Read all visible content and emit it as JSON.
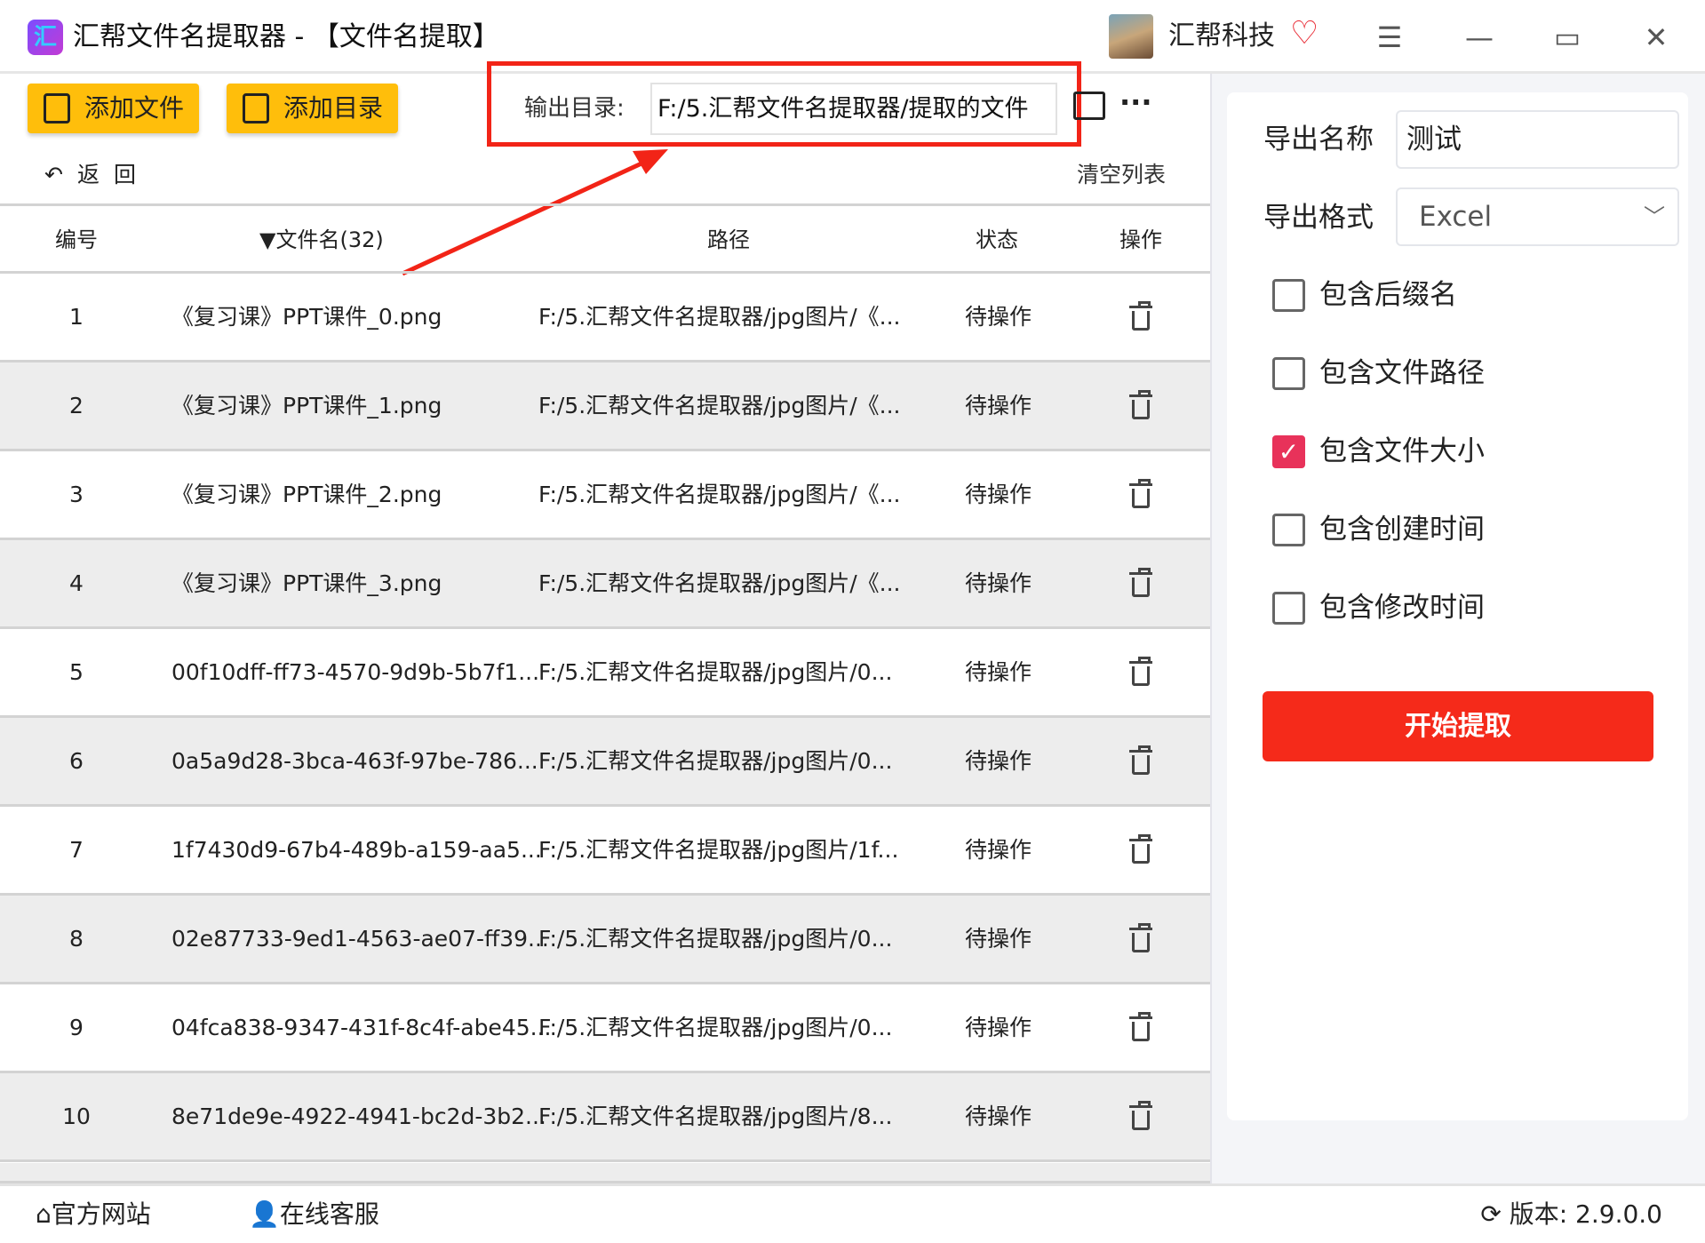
{
  "titlebar": {
    "logo_text": "汇",
    "title": "汇帮文件名提取器 - 【文件名提取】",
    "brand": "汇帮科技",
    "menu_icon": "☰",
    "minimize_icon": "—",
    "maximize_icon": "▭",
    "close_icon": "✕"
  },
  "toolbar": {
    "add_file": "添加文件",
    "add_dir": "添加目录",
    "output_label": "输出目录:",
    "output_value": "F:/5.汇帮文件名提取器/提取的文件",
    "more": "···",
    "back": "返回",
    "clear": "清空列表"
  },
  "table": {
    "headers": {
      "no": "编号",
      "name": "▼文件名(32)",
      "path": "路径",
      "status": "状态",
      "action": "操作"
    },
    "rows": [
      {
        "no": "1",
        "name": "《复习课》PPT课件_0.png",
        "path": "F:/5.汇帮文件名提取器/jpg图片/《...",
        "status": "待操作"
      },
      {
        "no": "2",
        "name": "《复习课》PPT课件_1.png",
        "path": "F:/5.汇帮文件名提取器/jpg图片/《...",
        "status": "待操作"
      },
      {
        "no": "3",
        "name": "《复习课》PPT课件_2.png",
        "path": "F:/5.汇帮文件名提取器/jpg图片/《...",
        "status": "待操作"
      },
      {
        "no": "4",
        "name": "《复习课》PPT课件_3.png",
        "path": "F:/5.汇帮文件名提取器/jpg图片/《...",
        "status": "待操作"
      },
      {
        "no": "5",
        "name": "00f10dff-ff73-4570-9d9b-5b7f1...",
        "path": "F:/5.汇帮文件名提取器/jpg图片/0...",
        "status": "待操作"
      },
      {
        "no": "6",
        "name": "0a5a9d28-3bca-463f-97be-786...",
        "path": "F:/5.汇帮文件名提取器/jpg图片/0...",
        "status": "待操作"
      },
      {
        "no": "7",
        "name": "1f7430d9-67b4-489b-a159-aa5...",
        "path": "F:/5.汇帮文件名提取器/jpg图片/1f...",
        "status": "待操作"
      },
      {
        "no": "8",
        "name": "02e87733-9ed1-4563-ae07-ff39...",
        "path": "F:/5.汇帮文件名提取器/jpg图片/0...",
        "status": "待操作"
      },
      {
        "no": "9",
        "name": "04fca838-9347-431f-8c4f-abe45...",
        "path": "F:/5.汇帮文件名提取器/jpg图片/0...",
        "status": "待操作"
      },
      {
        "no": "10",
        "name": "8e71de9e-4922-4941-bc2d-3b2...",
        "path": "F:/5.汇帮文件名提取器/jpg图片/8...",
        "status": "待操作"
      }
    ]
  },
  "settings": {
    "export_name_label": "导出名称",
    "export_name_value": "测试",
    "export_format_label": "导出格式",
    "export_format_value": "Excel",
    "options": [
      {
        "label": "包含后缀名",
        "checked": false
      },
      {
        "label": "包含文件路径",
        "checked": false
      },
      {
        "label": "包含文件大小",
        "checked": true
      },
      {
        "label": "包含创建时间",
        "checked": false
      },
      {
        "label": "包含修改时间",
        "checked": false
      }
    ],
    "start": "开始提取"
  },
  "footer": {
    "website": "官方网站",
    "service": "在线客服",
    "version": "版本: 2.9.0.0"
  },
  "colors": {
    "accent_yellow": "#ffbe0b",
    "start_red": "#f52a1a",
    "check_pink": "#e8325a",
    "highlight_red": "#f22417"
  }
}
